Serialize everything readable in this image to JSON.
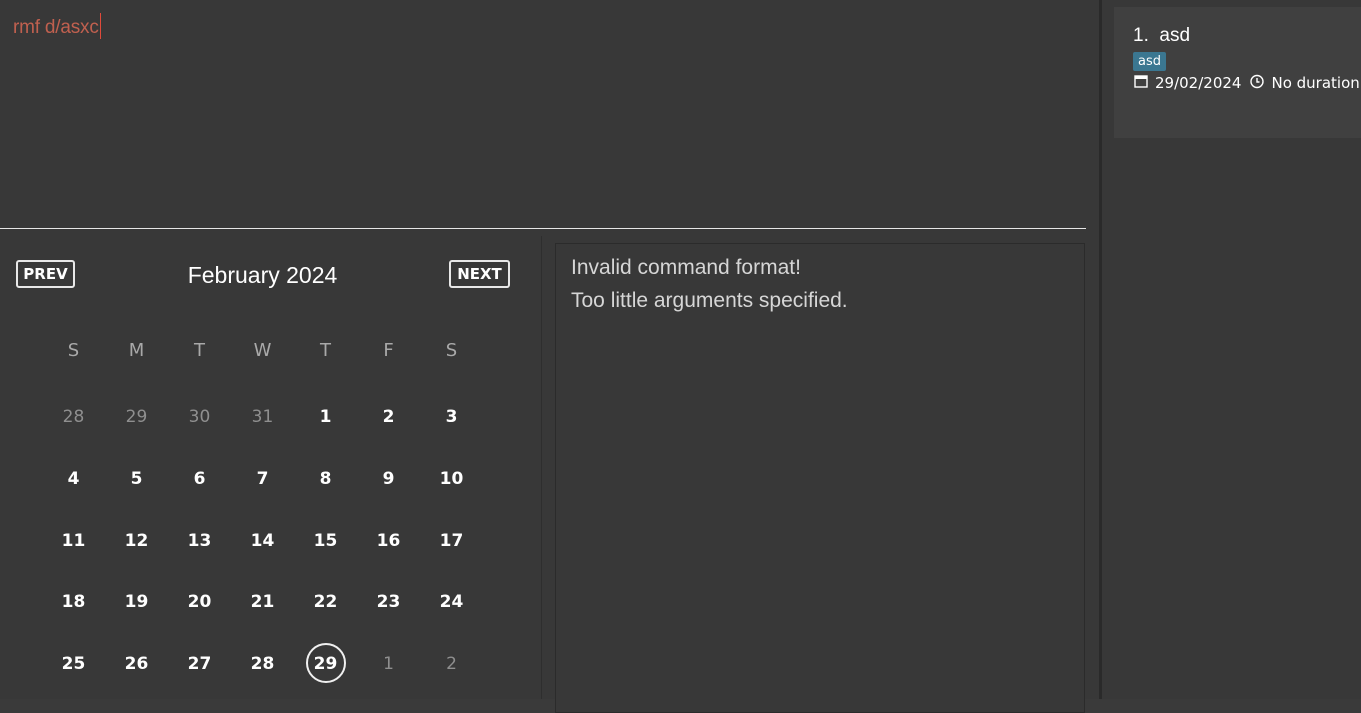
{
  "command": {
    "value": "rmf d/asxc"
  },
  "calendar": {
    "prev_label": "PREV",
    "next_label": "NEXT",
    "month_title": "February 2024",
    "weekdays": [
      "S",
      "M",
      "T",
      "W",
      "T",
      "F",
      "S"
    ],
    "days": [
      {
        "d": "28",
        "other": true
      },
      {
        "d": "29",
        "other": true
      },
      {
        "d": "30",
        "other": true
      },
      {
        "d": "31",
        "other": true
      },
      {
        "d": "1"
      },
      {
        "d": "2"
      },
      {
        "d": "3"
      },
      {
        "d": "4"
      },
      {
        "d": "5"
      },
      {
        "d": "6"
      },
      {
        "d": "7"
      },
      {
        "d": "8"
      },
      {
        "d": "9"
      },
      {
        "d": "10"
      },
      {
        "d": "11"
      },
      {
        "d": "12"
      },
      {
        "d": "13"
      },
      {
        "d": "14"
      },
      {
        "d": "15"
      },
      {
        "d": "16"
      },
      {
        "d": "17"
      },
      {
        "d": "18"
      },
      {
        "d": "19"
      },
      {
        "d": "20"
      },
      {
        "d": "21"
      },
      {
        "d": "22"
      },
      {
        "d": "23"
      },
      {
        "d": "24"
      },
      {
        "d": "25"
      },
      {
        "d": "26"
      },
      {
        "d": "27"
      },
      {
        "d": "28"
      },
      {
        "d": "29",
        "today": true
      },
      {
        "d": "1",
        "other": true
      },
      {
        "d": "2",
        "other": true
      }
    ]
  },
  "result": {
    "lines": [
      "Invalid command format!",
      "Too little arguments specified."
    ]
  },
  "tasks": [
    {
      "index": "1.",
      "name": "asd",
      "tag": "asd",
      "date": "29/02/2024",
      "duration": "No duration",
      "icons": [
        "calendar-icon",
        "clock-icon"
      ]
    }
  ],
  "colors": {
    "command_text": "#c0604f",
    "tag_bg": "#3b7791",
    "background": "#383838"
  }
}
